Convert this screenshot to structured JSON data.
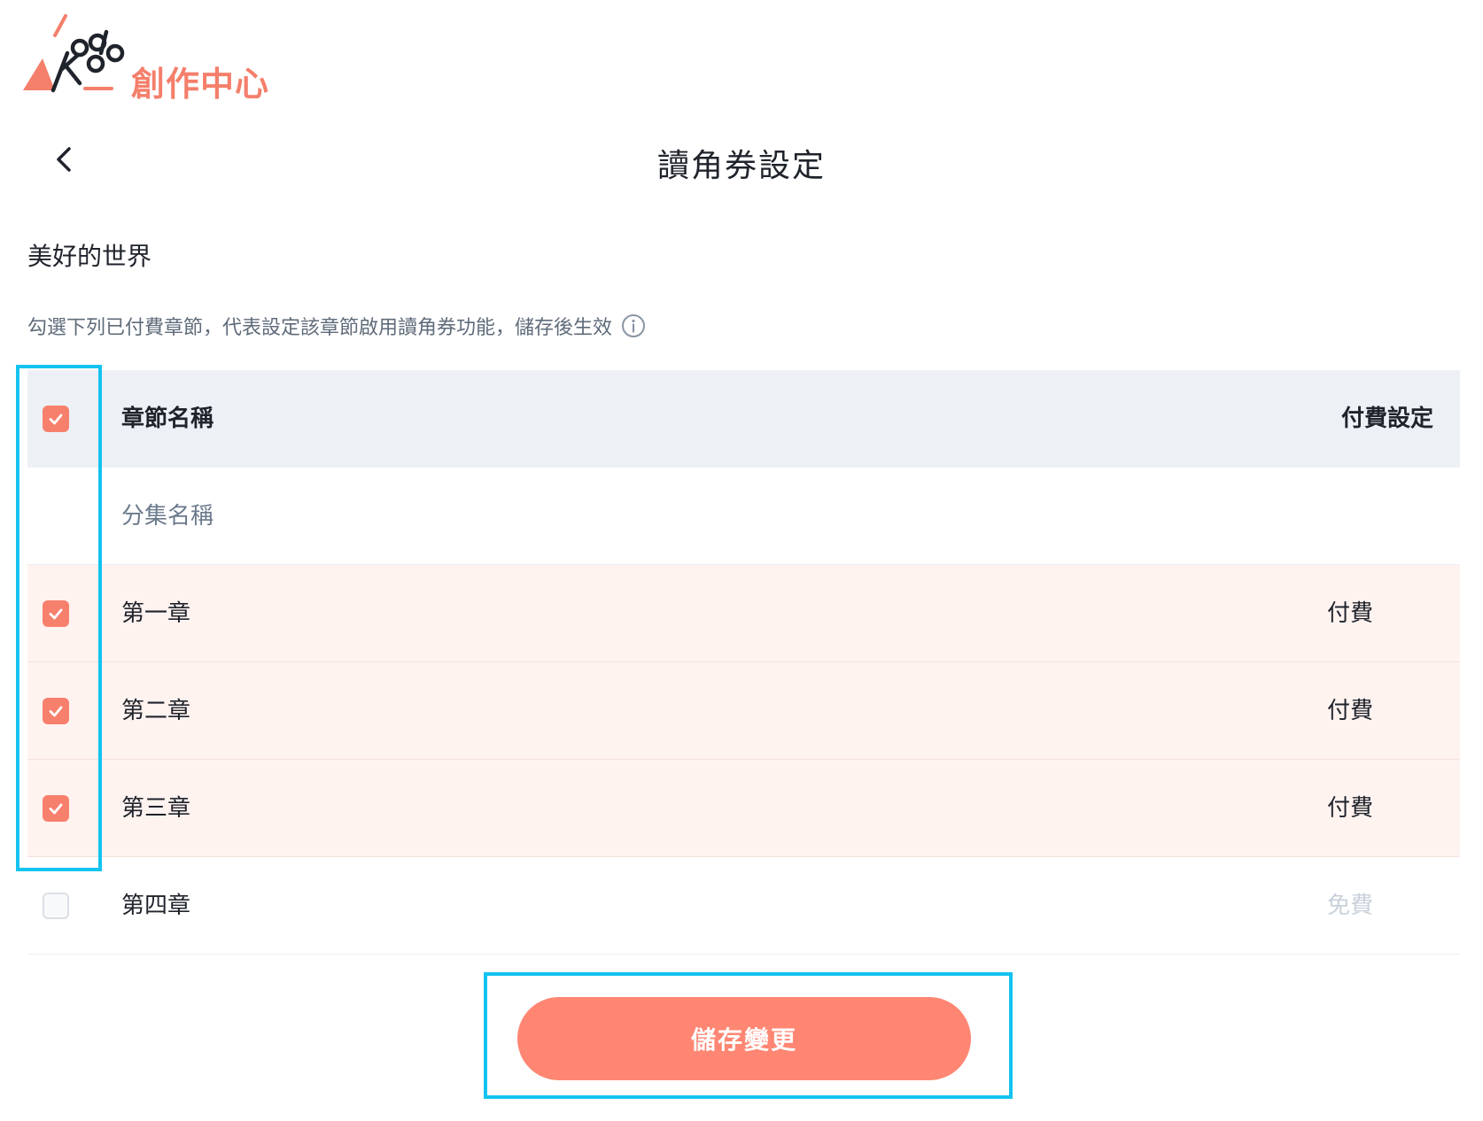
{
  "app": {
    "logo_text": "創作中心",
    "logo_mark_text": "Kodo"
  },
  "header": {
    "title": "讀角券設定"
  },
  "work": {
    "title": "美好的世界"
  },
  "hint": {
    "text": "勾選下列已付費章節，代表設定該章節啟用讀角券功能，儲存後生效"
  },
  "table": {
    "header": {
      "name_label": "章節名稱",
      "pay_label": "付費設定",
      "checked": true
    },
    "group_label": "分集名稱",
    "rows": [
      {
        "name": "第一章",
        "pay": "付費",
        "checked": true
      },
      {
        "name": "第二章",
        "pay": "付費",
        "checked": true
      },
      {
        "name": "第三章",
        "pay": "付費",
        "checked": true
      },
      {
        "name": "第四章",
        "pay": "免費",
        "checked": false
      }
    ]
  },
  "actions": {
    "save_label": "儲存變更"
  },
  "colors": {
    "accent": "#f7806d",
    "button": "#fe8673",
    "highlight": "#14c3ef",
    "header_bg": "#edf1f5",
    "selected_bg": "#fff3f0"
  }
}
